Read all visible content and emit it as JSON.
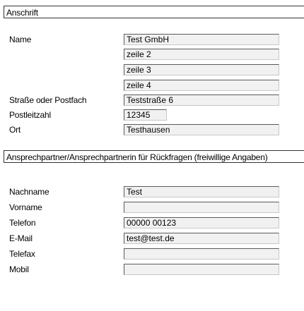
{
  "address": {
    "header": "Anschrift",
    "name_label": "Name",
    "name_values": [
      "Test GmbH",
      "zeile 2",
      "zeile 3",
      "zeile 4"
    ],
    "street_label": "Straße oder Postfach",
    "street_value": "Teststraße 6",
    "zip_label": "Postleitzahl",
    "zip_value": "12345",
    "city_label": "Ort",
    "city_value": "Testhausen"
  },
  "contact": {
    "header": "Ansprechpartner/Ansprechpartnerin für Rückfragen (freiwillige Angaben)",
    "lastname_label": "Nachname",
    "lastname_value": "Test",
    "firstname_label": "Vorname",
    "firstname_value": "",
    "phone_label": "Telefon",
    "phone_value": "00000 00123",
    "email_label": "E-Mail",
    "email_value": "test@test.de",
    "fax_label": "Telefax",
    "fax_value": "",
    "mobile_label": "Mobil",
    "mobile_value": ""
  }
}
